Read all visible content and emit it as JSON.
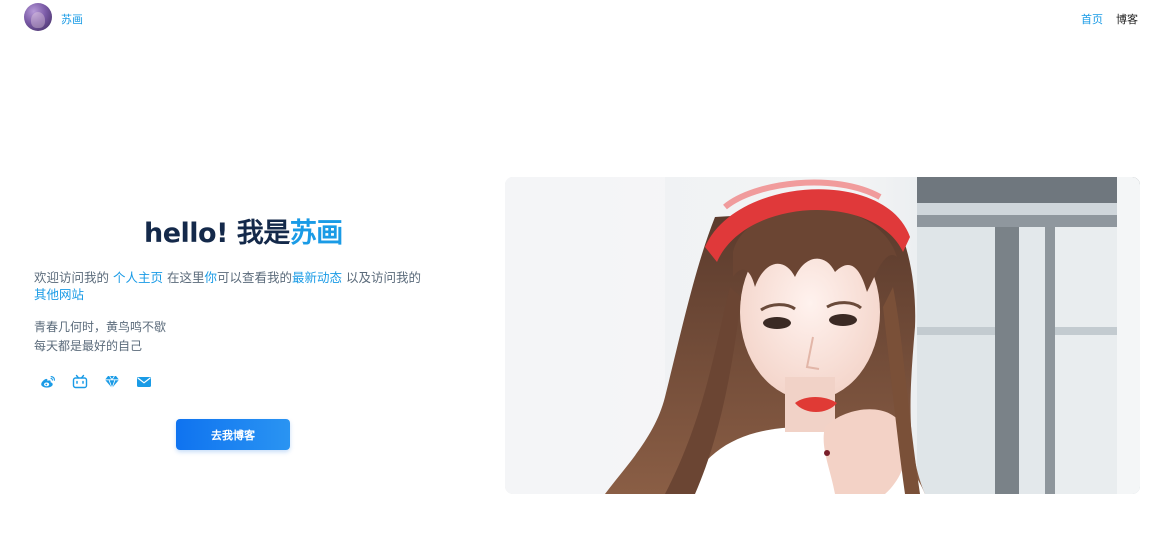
{
  "header": {
    "site_name": "苏画",
    "nav": [
      {
        "label": "首页",
        "active": true
      },
      {
        "label": "博客",
        "active": false
      }
    ]
  },
  "intro": {
    "greeting": "hello! 我是",
    "name": "苏画",
    "desc": {
      "p1": "欢迎访问我的 ",
      "link1": "个人主页",
      "p2": " 在这里",
      "p2b": "你",
      "p2c": "可以查看我的",
      "link2": "最新动态",
      "p3": " 以及访问我的",
      "link3": "其他网站"
    },
    "quote_line1": "青春几何时，黄鸟鸣不歇",
    "quote_line2": "每天都是最好的自己"
  },
  "socials": [
    {
      "icon": "weibo-icon"
    },
    {
      "icon": "bilibili-icon"
    },
    {
      "icon": "diamond-icon"
    },
    {
      "icon": "mail-icon"
    }
  ],
  "cta": {
    "label": "去我博客"
  },
  "colors": {
    "accent": "#1a9be6",
    "heading": "#14294a",
    "button": "#1677f0"
  }
}
